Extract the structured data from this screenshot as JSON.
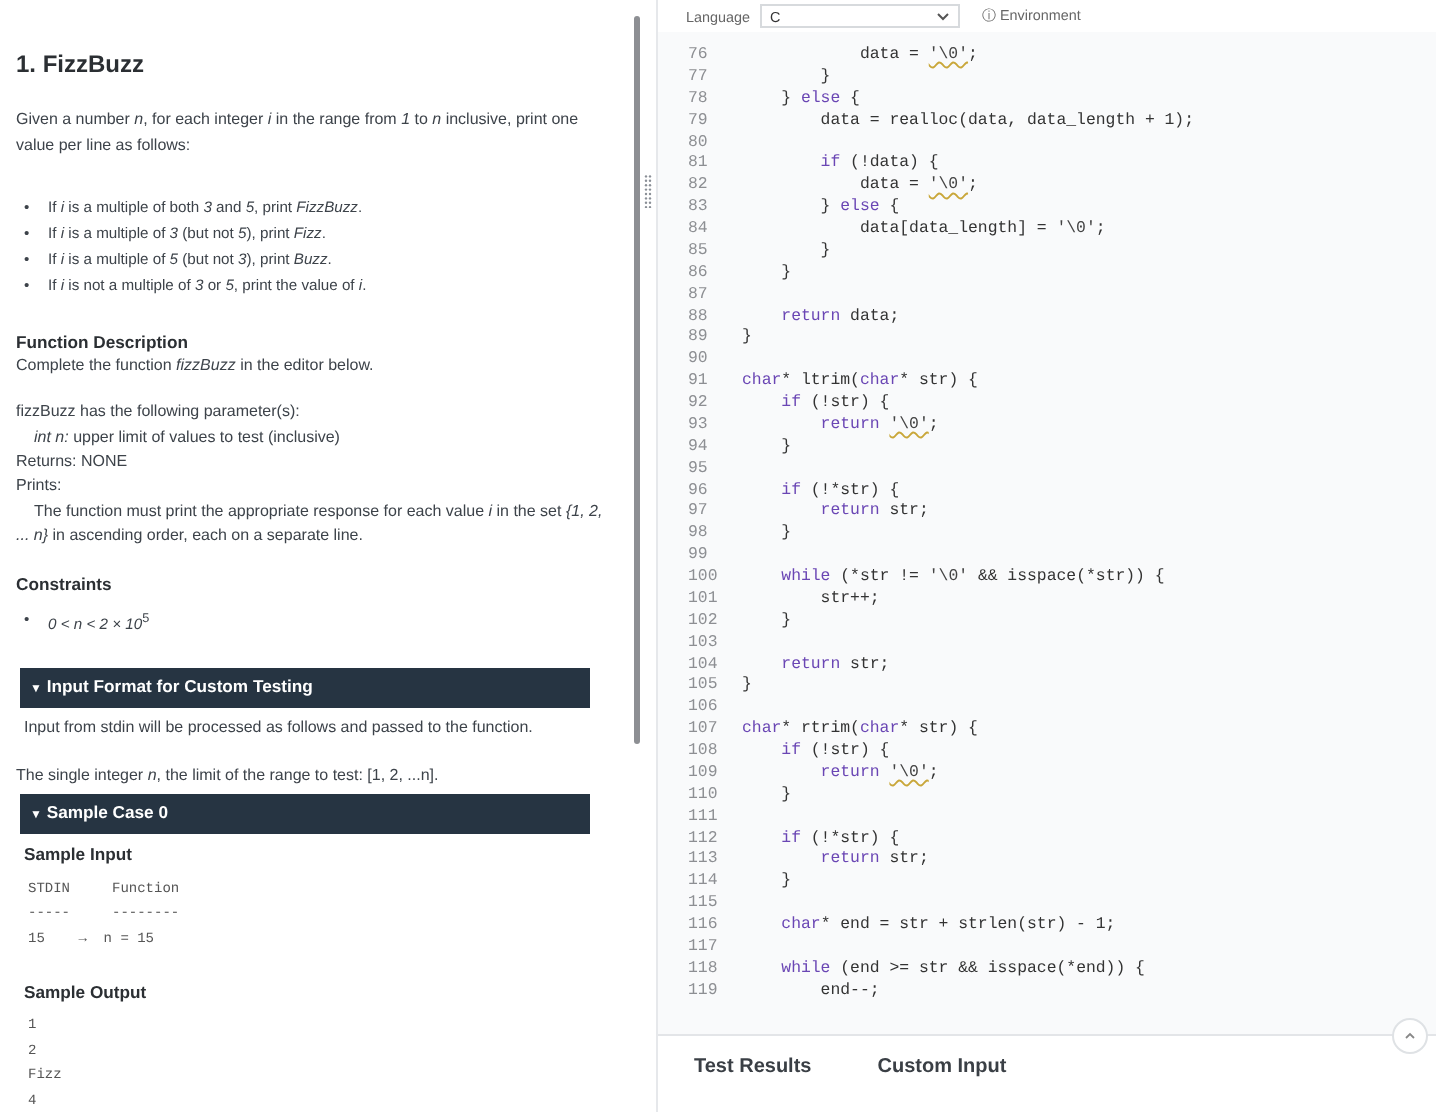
{
  "problem": {
    "blocks": [
      {
        "kind": "title",
        "text": "1. FizzBuzz"
      },
      {
        "kind": "para",
        "text": "Given a number *n*, for each integer *i* in the range from *1* to *n* inclusive, print one value per line as follows:"
      },
      {
        "kind": "bullets",
        "marker": "•",
        "items": [
          "If *i* is a multiple of both *3* and *5*, print *FizzBuzz*.",
          "If *i* is a multiple of *3* (but not *5*), print *Fizz*.",
          "If *i* is a multiple of *5* (but not *3*), print *Buzz*.",
          "If *i* is not a multiple of *3* or *5*, print the value of *i*."
        ]
      },
      {
        "kind": "heading",
        "text": "Function Description"
      },
      {
        "kind": "line",
        "text": "Complete the function *fizzBuzz* in the editor below."
      },
      {
        "kind": "gap"
      },
      {
        "kind": "line",
        "text": "fizzBuzz has the following parameter(s):"
      },
      {
        "kind": "indent",
        "text": "*int n:*  upper limit of values to test (inclusive)"
      },
      {
        "kind": "line",
        "text": "Returns:   NONE"
      },
      {
        "kind": "line",
        "text": "Prints:"
      },
      {
        "kind": "hanging",
        "text": "The function must print the appropriate response for each value *i* in the set *{1, 2, ... n}* in ascending order, each on a separate line."
      },
      {
        "kind": "heading",
        "text": "Constraints"
      },
      {
        "kind": "bullets",
        "marker": "•",
        "items": [
          "*0 < n < 2 × 10*$^{5}$"
        ]
      },
      {
        "kind": "bar",
        "marker": "▼",
        "text": "Input Format for Custom Testing"
      },
      {
        "kind": "note",
        "text": "Input from stdin will be processed as follows and passed to the function."
      },
      {
        "kind": "gap"
      },
      {
        "kind": "line",
        "text": "The single integer *n*, the limit of the range to test: [1, 2, ...n]."
      },
      {
        "kind": "bar",
        "marker": "▼",
        "text": "Sample Case 0"
      },
      {
        "kind": "subheading",
        "text": "Sample Input"
      },
      {
        "kind": "pre",
        "lines": [
          "STDIN     Function",
          "-----     --------",
          "15    →  n = 15"
        ]
      },
      {
        "kind": "subheading",
        "text": "Sample Output"
      },
      {
        "kind": "pre",
        "lines": [
          "1",
          "2",
          "Fizz",
          "4"
        ]
      }
    ]
  },
  "editor": {
    "language_label": "Language",
    "language": "C",
    "environment": "Environment",
    "environment_icon": "ⓘ",
    "lines": [
      {
        "n": "76",
        "parts": [
          {
            "kind": "plain",
            "text": "            data = "
          },
          {
            "kind": "warn",
            "text": "'\\0'"
          },
          {
            "kind": "plain",
            "text": ";"
          }
        ]
      },
      {
        "n": "77",
        "parts": [
          {
            "kind": "plain",
            "text": "        }"
          }
        ]
      },
      {
        "n": "78",
        "parts": [
          {
            "kind": "plain",
            "text": "    } "
          },
          {
            "kind": "kw",
            "text": "else"
          },
          {
            "kind": "plain",
            "text": " {"
          }
        ]
      },
      {
        "n": "79",
        "parts": [
          {
            "kind": "plain",
            "text": "        data = realloc(data, data_length + 1);"
          }
        ]
      },
      {
        "n": "80"
      },
      {
        "n": "81",
        "parts": [
          {
            "kind": "kw",
            "text": "        if"
          },
          {
            "kind": "plain",
            "text": " (!data) {"
          }
        ]
      },
      {
        "n": "82",
        "parts": [
          {
            "kind": "plain",
            "text": "            data = "
          },
          {
            "kind": "warn",
            "text": "'\\0'"
          },
          {
            "kind": "plain",
            "text": ";"
          }
        ]
      },
      {
        "n": "83",
        "parts": [
          {
            "kind": "plain",
            "text": "        } "
          },
          {
            "kind": "kw",
            "text": "else"
          },
          {
            "kind": "plain",
            "text": " {"
          }
        ]
      },
      {
        "n": "84",
        "parts": [
          {
            "kind": "plain",
            "text": "            data[data_length] = "
          },
          {
            "kind": "str",
            "text": "'\\0'"
          },
          {
            "kind": "plain",
            "text": ";"
          }
        ]
      },
      {
        "n": "85",
        "parts": [
          {
            "kind": "plain",
            "text": "        }"
          }
        ]
      },
      {
        "n": "86",
        "parts": [
          {
            "kind": "plain",
            "text": "    }"
          }
        ]
      },
      {
        "n": "87"
      },
      {
        "n": "88",
        "parts": [
          {
            "kind": "kw",
            "text": "    return"
          },
          {
            "kind": "plain",
            "text": " data;"
          }
        ]
      },
      {
        "n": "89",
        "parts": [
          {
            "kind": "plain",
            "text": "}"
          }
        ]
      },
      {
        "n": "90"
      },
      {
        "n": "91",
        "parts": [
          {
            "kind": "kw",
            "text": "char"
          },
          {
            "kind": "plain",
            "text": "* ltrim("
          },
          {
            "kind": "kw",
            "text": "char"
          },
          {
            "kind": "plain",
            "text": "* str) {"
          }
        ]
      },
      {
        "n": "92",
        "parts": [
          {
            "kind": "kw",
            "text": "    if"
          },
          {
            "kind": "plain",
            "text": " (!str) {"
          }
        ]
      },
      {
        "n": "93",
        "parts": [
          {
            "kind": "kw",
            "text": "        return "
          },
          {
            "kind": "warn",
            "text": "'\\0'"
          },
          {
            "kind": "plain",
            "text": ";"
          }
        ]
      },
      {
        "n": "94",
        "parts": [
          {
            "kind": "plain",
            "text": "    }"
          }
        ]
      },
      {
        "n": "95"
      },
      {
        "n": "96",
        "parts": [
          {
            "kind": "kw",
            "text": "    if"
          },
          {
            "kind": "plain",
            "text": " (!*str) {"
          }
        ]
      },
      {
        "n": "97",
        "parts": [
          {
            "kind": "kw",
            "text": "        return"
          },
          {
            "kind": "plain",
            "text": " str;"
          }
        ]
      },
      {
        "n": "98",
        "parts": [
          {
            "kind": "plain",
            "text": "    }"
          }
        ]
      },
      {
        "n": "99"
      },
      {
        "n": "100",
        "parts": [
          {
            "kind": "kw",
            "text": "    while"
          },
          {
            "kind": "plain",
            "text": " (*str != "
          },
          {
            "kind": "str",
            "text": "'\\0'"
          },
          {
            "kind": "plain",
            "text": " && isspace(*str)) {"
          }
        ]
      },
      {
        "n": "101",
        "parts": [
          {
            "kind": "plain",
            "text": "        str++;"
          }
        ]
      },
      {
        "n": "102",
        "parts": [
          {
            "kind": "plain",
            "text": "    }"
          }
        ]
      },
      {
        "n": "103"
      },
      {
        "n": "104",
        "parts": [
          {
            "kind": "kw",
            "text": "    return"
          },
          {
            "kind": "plain",
            "text": " str;"
          }
        ]
      },
      {
        "n": "105",
        "parts": [
          {
            "kind": "plain",
            "text": "}"
          }
        ]
      },
      {
        "n": "106"
      },
      {
        "n": "107",
        "parts": [
          {
            "kind": "kw",
            "text": "char"
          },
          {
            "kind": "plain",
            "text": "* rtrim("
          },
          {
            "kind": "kw",
            "text": "char"
          },
          {
            "kind": "plain",
            "text": "* str) {"
          }
        ]
      },
      {
        "n": "108",
        "parts": [
          {
            "kind": "kw",
            "text": "    if"
          },
          {
            "kind": "plain",
            "text": " (!str) {"
          }
        ]
      },
      {
        "n": "109",
        "parts": [
          {
            "kind": "kw",
            "text": "        return "
          },
          {
            "kind": "warn",
            "text": "'\\0'"
          },
          {
            "kind": "plain",
            "text": ";"
          }
        ]
      },
      {
        "n": "110",
        "parts": [
          {
            "kind": "plain",
            "text": "    }"
          }
        ]
      },
      {
        "n": "111"
      },
      {
        "n": "112",
        "parts": [
          {
            "kind": "kw",
            "text": "    if"
          },
          {
            "kind": "plain",
            "text": " (!*str) {"
          }
        ]
      },
      {
        "n": "113",
        "parts": [
          {
            "kind": "kw",
            "text": "        return"
          },
          {
            "kind": "plain",
            "text": " str;"
          }
        ]
      },
      {
        "n": "114",
        "parts": [
          {
            "kind": "plain",
            "text": "    }"
          }
        ]
      },
      {
        "n": "115"
      },
      {
        "n": "116",
        "parts": [
          {
            "kind": "kw",
            "text": "    char"
          },
          {
            "kind": "plain",
            "text": "* end = str + strlen(str) - 1;"
          }
        ]
      },
      {
        "n": "117"
      },
      {
        "n": "118",
        "parts": [
          {
            "kind": "kw",
            "text": "    while"
          },
          {
            "kind": "plain",
            "text": " (end >= str && isspace(*end)) {"
          }
        ]
      },
      {
        "n": "119",
        "parts": [
          {
            "kind": "plain",
            "text": "        end--;"
          }
        ]
      }
    ]
  },
  "bottom_tabs": [
    {
      "label": "Test Results"
    },
    {
      "label": "Custom Input"
    }
  ]
}
